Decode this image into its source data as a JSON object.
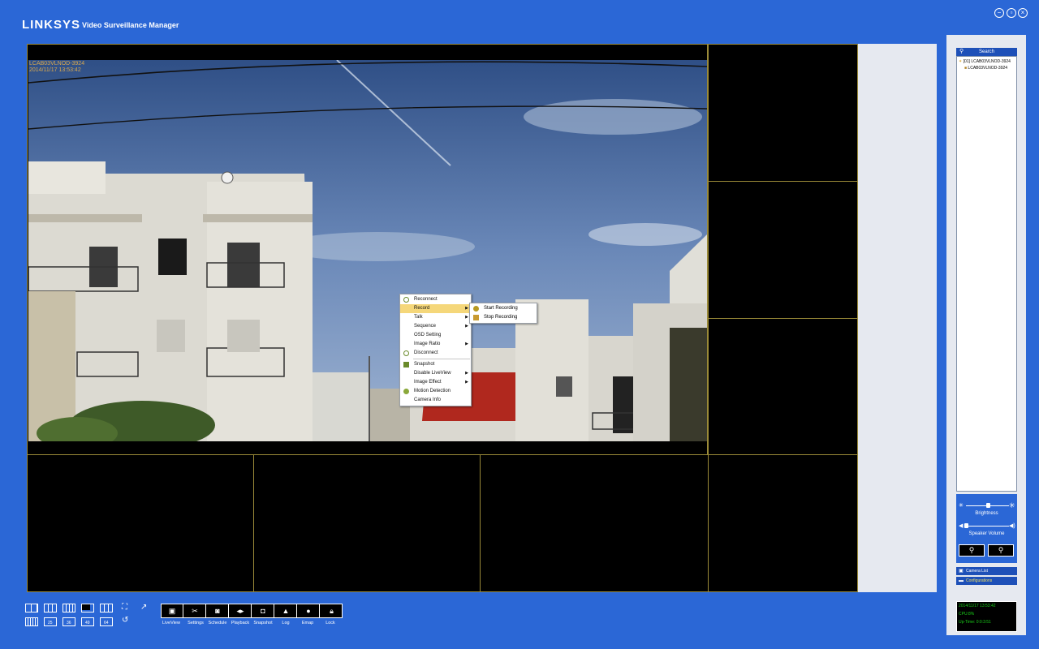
{
  "app": {
    "brand": "LINKSYS",
    "title": "Video Surveillance Manager"
  },
  "window_controls": [
    "minimize-icon",
    "restore-icon",
    "close-icon"
  ],
  "video": {
    "osd_camera": "LCAB03VLNOD-3924",
    "osd_datetime": "2014/11/17 13:53:42"
  },
  "context_menu": {
    "items": [
      {
        "label": "Reconnect",
        "icon": "link-icon",
        "submenu": false
      },
      {
        "label": "Record",
        "icon": "",
        "submenu": true,
        "highlighted": true
      },
      {
        "label": "Talk",
        "icon": "",
        "submenu": true
      },
      {
        "label": "Sequence",
        "icon": "",
        "submenu": true
      },
      {
        "label": "OSD Setting",
        "icon": "",
        "submenu": false
      },
      {
        "label": "Image Ratio",
        "icon": "",
        "submenu": true
      },
      {
        "label": "Disconnect",
        "icon": "broken-link-icon",
        "submenu": false
      },
      {
        "label": "Snapshot",
        "icon": "camera-icon",
        "submenu": false
      },
      {
        "label": "Disable LiveView",
        "icon": "",
        "submenu": true
      },
      {
        "label": "Image Effect",
        "icon": "",
        "submenu": true
      },
      {
        "label": "Motion Detection",
        "icon": "motion-icon",
        "submenu": false
      },
      {
        "label": "Camera Info",
        "icon": "",
        "submenu": false
      }
    ],
    "record_submenu": [
      {
        "label": "Start Recording",
        "icon": "record-start-icon"
      },
      {
        "label": "Stop Recording",
        "icon": "record-stop-icon"
      }
    ]
  },
  "right_panel": {
    "search_label": "Search",
    "tree": {
      "group": "[01] LCAB03VLNOD-3924",
      "camera": "LCAB03VLNOD-3924"
    },
    "brightness_label": "Brightness",
    "speaker_label": "Speaker Volume",
    "brightness_level": 0.5,
    "speaker_level": 0.0,
    "tabs": [
      "Camera List",
      "Configurations"
    ]
  },
  "status": {
    "datetime": "2014/11/17 13:53:42",
    "cpu": "CPU:8%",
    "uptime": "Up-Time: 0:0:3:51"
  },
  "layout_buttons": {
    "numbered": [
      "25",
      "36",
      "49",
      "64"
    ]
  },
  "toolbar": {
    "labels": [
      "LiveView",
      "Settings",
      "Schedule",
      "Playback",
      "Snapshot",
      "Log",
      "Emap",
      "Lock"
    ]
  }
}
